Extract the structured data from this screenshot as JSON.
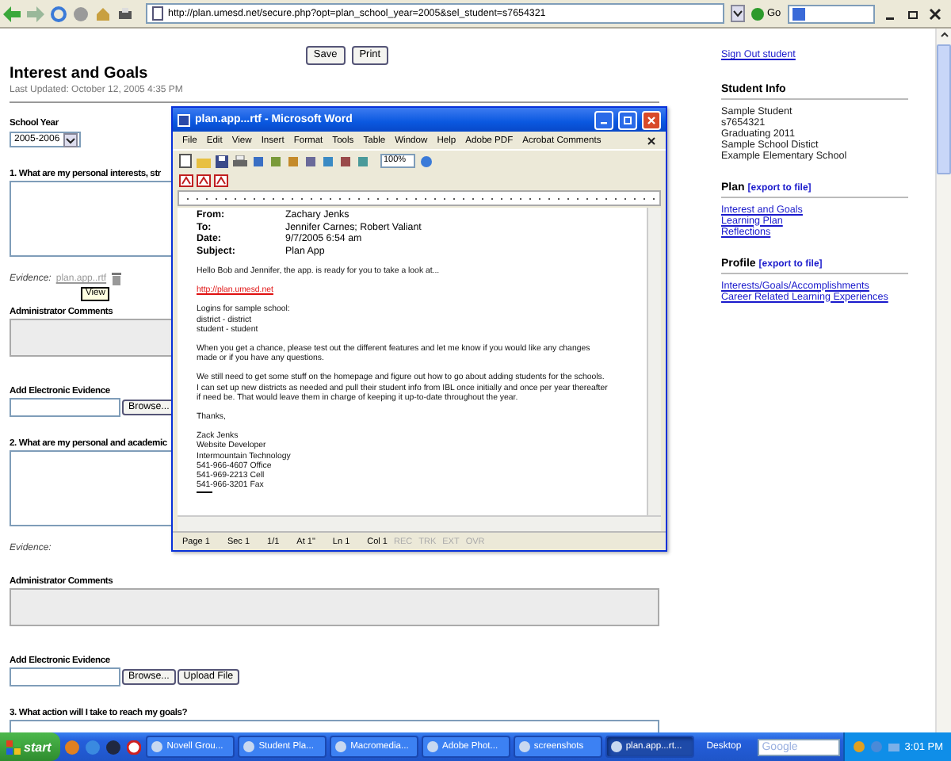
{
  "browser": {
    "url": "http://plan.umesd.net/secure.php?opt=plan_school_year=2005&sel_student=s7654321",
    "go": "Go"
  },
  "actions": [
    "Save",
    "Print"
  ],
  "page": {
    "title": "Interest and Goals",
    "updated": "Last Updated: October 12, 2005 4:35 PM"
  },
  "school_year": {
    "label": "School Year",
    "value": "2005-2006"
  },
  "questions": [
    {
      "label": "1. What are my personal interests, str",
      "evidence_label": "Evidence:",
      "evidence_link": "plan.app..rtf",
      "tooltip": "View",
      "admin_label": "Administrator Comments",
      "add_label": "Add Electronic Evidence",
      "browse": "Browse..."
    },
    {
      "label": "2. What are my personal and academic",
      "evidence_label": "Evidence:",
      "admin_label": "Administrator Comments",
      "add_label": "Add Electronic Evidence",
      "browse": "Browse...",
      "upload": "Upload File"
    },
    {
      "label": "3. What action will I take to reach my goals?"
    }
  ],
  "sidebar": {
    "sign_out": "Sign Out student",
    "student_info": {
      "heading": "Student Info",
      "lines": [
        "Sample Student",
        "s7654321",
        "Graduating 2011",
        "Sample School Distict",
        "Example Elementary School"
      ]
    },
    "sections": [
      {
        "heading": "Plan",
        "export": "[export to file]",
        "links": [
          "Interest and Goals",
          "Learning Plan",
          "Reflections"
        ]
      },
      {
        "heading": "Profile",
        "export": "[export to file]",
        "links": [
          "Interests/Goals/Accomplishments",
          "Career Related Learning Experiences"
        ]
      }
    ]
  },
  "word": {
    "title": "plan.app...rtf - Microsoft Word",
    "menus": [
      "File",
      "Edit",
      "View",
      "Insert",
      "Format",
      "Tools",
      "Table",
      "Window",
      "Help",
      "Adobe PDF",
      "Acrobat Comments"
    ],
    "zoom": "100%",
    "fields": [
      {
        "label": "From:",
        "value": "Zachary Jenks"
      },
      {
        "label": "To:",
        "value": "Jennifer Carnes;  Robert Valiant"
      },
      {
        "label": "Date:",
        "value": "9/7/2005 6:54 am"
      },
      {
        "label": "Subject:",
        "value": "Plan App"
      }
    ],
    "paragraphs": [
      {
        "kind": "text",
        "lines": [
          "Hello Bob and Jennifer, the app. is ready for you to take a look at..."
        ]
      },
      {
        "kind": "link",
        "lines": [
          "http://plan.umesd.net"
        ]
      },
      {
        "kind": "text",
        "lines": [
          "Logins for sample school:",
          "district - district",
          "student - student"
        ]
      },
      {
        "kind": "text",
        "lines": [
          "When you get a chance, please test out the different features and let me know if you would like any changes",
          "made or if you have any questions."
        ]
      },
      {
        "kind": "text",
        "lines": [
          "We still need to get some stuff on the homepage and figure out how to go about adding students for the schools.",
          "I can set up new districts as needed and pull their student info from IBL once initially and once per year thereafter",
          "if need be.  That would leave them in charge of keeping it up-to-date throughout the year."
        ]
      },
      {
        "kind": "text",
        "lines": [
          "Thanks,"
        ]
      },
      {
        "kind": "text",
        "lines": [
          "Zack Jenks",
          "Website Developer",
          "Intermountain Technology",
          "541-966-4607   Office",
          "541-969-2213   Cell",
          "541-966-3201   Fax"
        ]
      }
    ],
    "status": [
      {
        "text": "Page 1",
        "enabled": true
      },
      {
        "text": "Sec 1",
        "enabled": true
      },
      {
        "text": "1/1",
        "enabled": true
      },
      {
        "text": "At 1\"",
        "enabled": true
      },
      {
        "text": "Ln 1",
        "enabled": true
      },
      {
        "text": "Col 1",
        "enabled": true
      },
      {
        "text": "REC",
        "enabled": false
      },
      {
        "text": "TRK",
        "enabled": false
      },
      {
        "text": "EXT",
        "enabled": false
      },
      {
        "text": "OVR",
        "enabled": false
      }
    ]
  },
  "taskbar": {
    "start": "start",
    "items": [
      {
        "label": "Novell Grou...",
        "selected": false
      },
      {
        "label": "Student Pla...",
        "selected": false
      },
      {
        "label": "Macromedia...",
        "selected": false
      },
      {
        "label": "Adobe Phot...",
        "selected": false
      },
      {
        "label": "screenshots",
        "selected": false
      },
      {
        "label": "plan.app...rt...",
        "selected": true
      }
    ],
    "desktop": "Desktop",
    "search": {
      "placeholder": "Google"
    },
    "time": "3:01 PM"
  }
}
